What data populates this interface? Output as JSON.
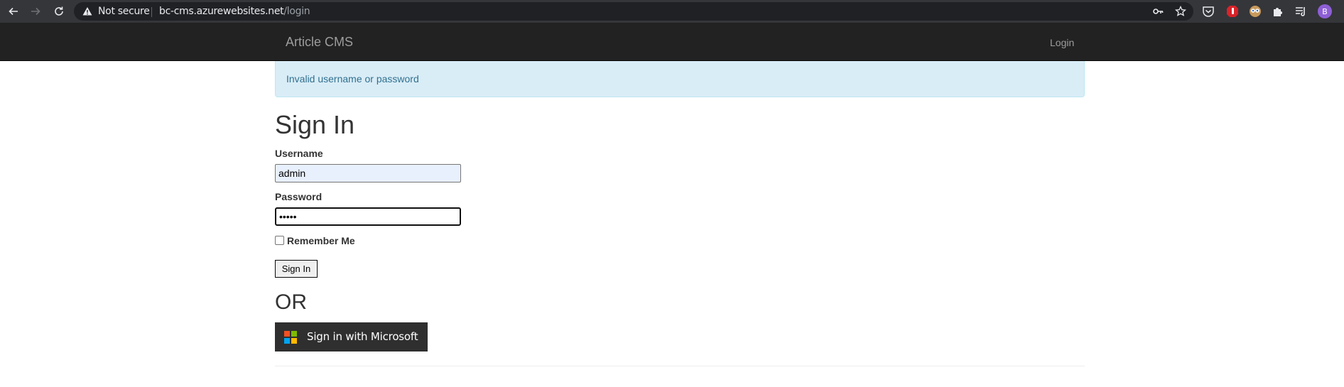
{
  "browser": {
    "security_label": "Not secure",
    "url_host": "bc-cms.azurewebsites.net",
    "url_path": "/login",
    "profile_initial": "B"
  },
  "navbar": {
    "brand": "Article CMS",
    "login_link": "Login"
  },
  "alert": {
    "message": "Invalid username or password"
  },
  "form": {
    "title": "Sign In",
    "username_label": "Username",
    "username_value": "admin",
    "password_label": "Password",
    "password_value": "•••••",
    "remember_label": "Remember Me",
    "remember_checked": false,
    "submit_label": "Sign In"
  },
  "alt_signin": {
    "or_text": "OR",
    "microsoft_button": "Sign in with Microsoft"
  },
  "colors": {
    "navbar_bg": "#222222",
    "alert_bg": "#d9edf7",
    "alert_text": "#31708f",
    "ms_button_bg": "#2f2f2f",
    "ms_red": "#f25022",
    "ms_green": "#7fba00",
    "ms_blue": "#00a4ef",
    "ms_yellow": "#ffb900"
  },
  "icons": [
    "back-arrow-icon",
    "forward-arrow-icon",
    "reload-icon",
    "warning-icon",
    "key-icon",
    "star-icon",
    "pocket-icon",
    "adblock-icon",
    "owl-extension-icon",
    "puzzle-icon",
    "reading-list-icon",
    "microsoft-logo-icon"
  ]
}
